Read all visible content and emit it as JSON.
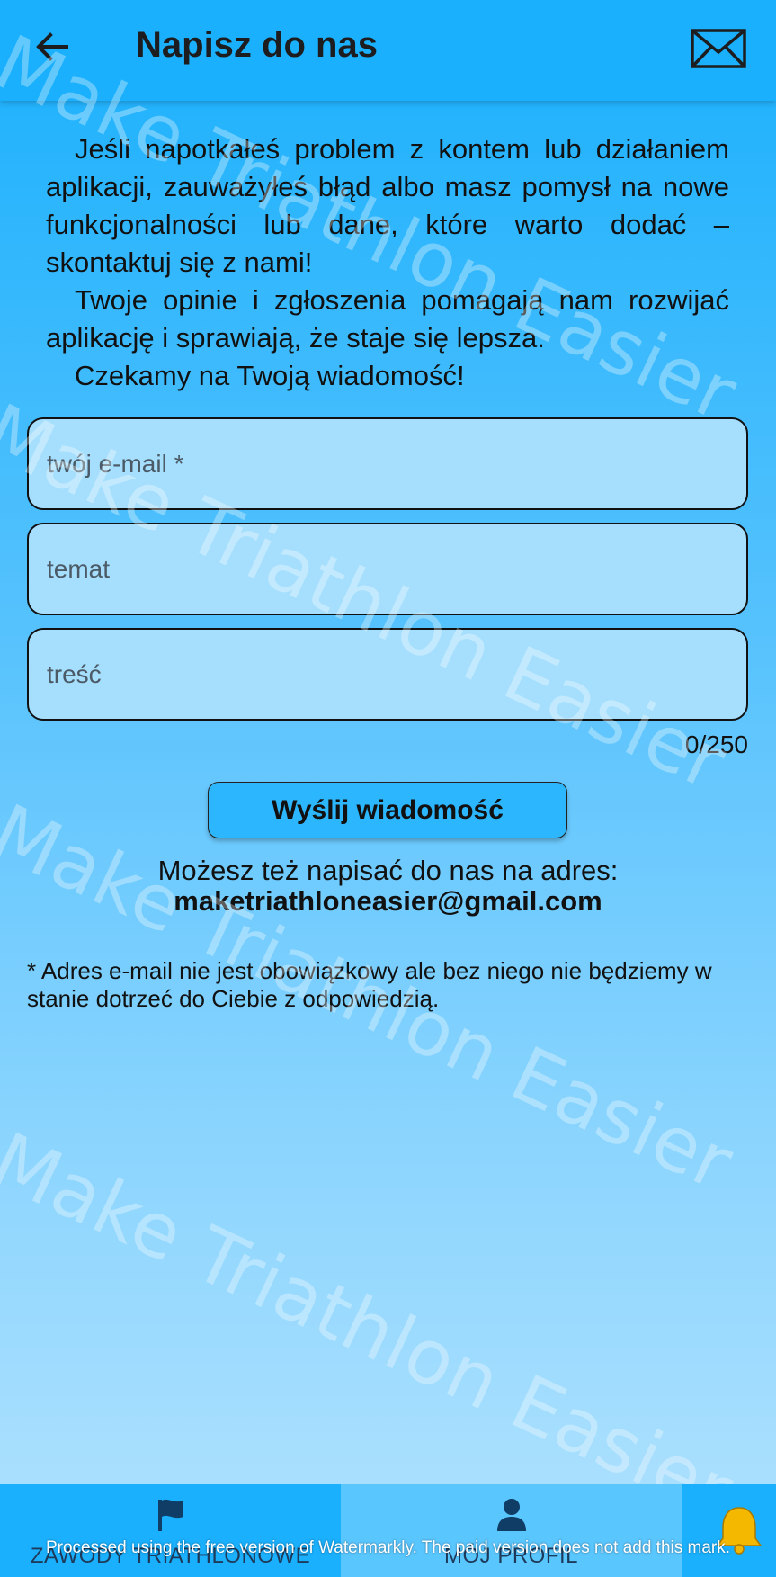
{
  "header": {
    "title": "Napisz do nas"
  },
  "intro": {
    "p1": "Jeśli napotkałeś problem z kontem lub działaniem aplikacji, zauważyłeś błąd albo masz pomysł na nowe funkcjonalności lub dane, które warto dodać – skontaktuj się z nami!",
    "p2": "Twoje opinie i zgłoszenia pomagają nam rozwijać aplikację i sprawiają, że staje się lepsza.",
    "p3": "Czekamy na Twoją wiadomość!"
  },
  "form": {
    "email_placeholder": "twój e-mail *",
    "subject_placeholder": "temat",
    "message_placeholder": "treść",
    "counter": "0/250",
    "send_label": "Wyślij wiadomość"
  },
  "contact": {
    "text": "Możesz też napisać do nas na adres:",
    "email": "maketriathloneasier@gmail.com"
  },
  "footnote": "* Adres e-mail nie jest obowiązkowy ale bez niego nie będziemy w stanie dotrzeć do Ciebie z odpowiedzią.",
  "watermark": {
    "text": "Make Triathlon Easier",
    "footer": "Processed using the free version of Watermarkly. The paid version does not add this mark."
  },
  "bottom_nav": {
    "items": [
      {
        "label": "ZAWODY TRIATHLONOWE",
        "icon": "flag-icon"
      },
      {
        "label": "MÓJ PROFIL",
        "icon": "person-icon"
      },
      {
        "label": "",
        "icon": "bell-icon"
      }
    ]
  },
  "colors": {
    "appbar": "#1ab0fd",
    "field_bg": "#a5dffd",
    "button_bg": "#2cb6fd",
    "active_tab": "#5ac6fe",
    "bell": "#f5b800"
  }
}
